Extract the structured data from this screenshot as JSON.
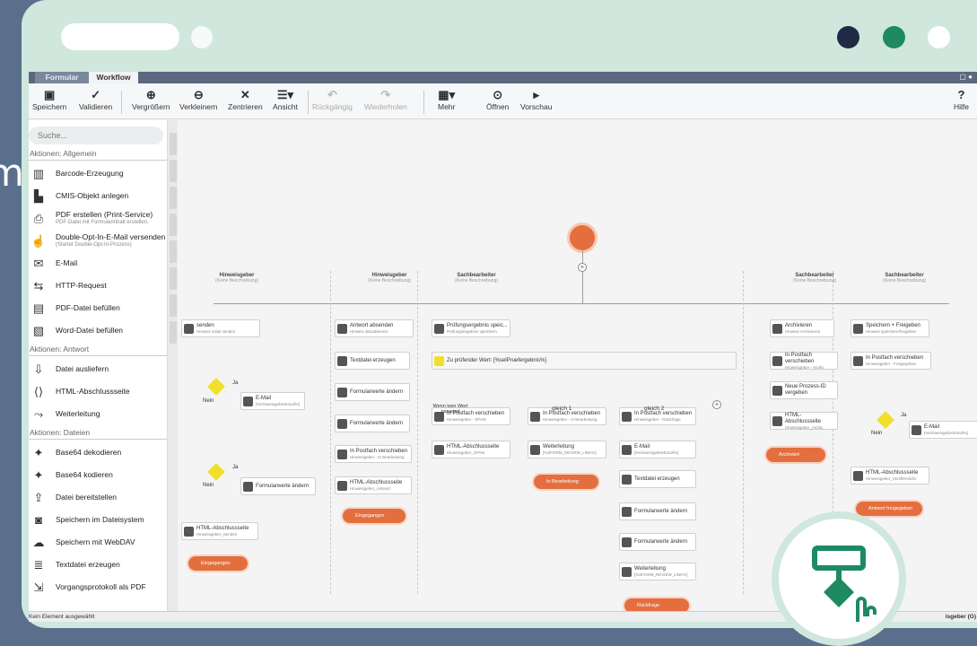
{
  "tabs": {
    "formular": "Formular",
    "workflow": "Workflow"
  },
  "toolbar": {
    "save": "Speichern",
    "validate": "Validieren",
    "zoom_in": "Vergrößern",
    "zoom_out": "Verkleinern",
    "center": "Zentrieren",
    "view": "Ansicht",
    "undo": "Rückgängig",
    "redo": "Wiederholen",
    "more": "Mehr",
    "open": "Öffnen",
    "preview": "Vorschau",
    "help": "Hilfe"
  },
  "search": {
    "placeholder": "Suche..."
  },
  "sections": [
    {
      "title": "Aktionen: Allgemein",
      "items": [
        {
          "label": "Barcode-Erzeugung",
          "sub": "",
          "icon": "barcode-icon"
        },
        {
          "label": "CMIS-Objekt anlegen",
          "sub": "",
          "icon": "cmis-icon"
        },
        {
          "label": "PDF erstellen (Print-Service)",
          "sub": "PDF-Datei mit Formularinhalt erstellen.",
          "icon": "printer-icon"
        },
        {
          "label": "Double-Opt-In-E-Mail versenden",
          "sub": "(Startet Double-Opt-In-Prozess)",
          "icon": "hand-icon"
        },
        {
          "label": "E-Mail",
          "sub": "",
          "icon": "mail-icon"
        },
        {
          "label": "HTTP-Request",
          "sub": "",
          "icon": "http-icon"
        },
        {
          "label": "PDF-Datei befüllen",
          "sub": "",
          "icon": "pdf-icon"
        },
        {
          "label": "Word-Datei befüllen",
          "sub": "",
          "icon": "word-icon"
        }
      ]
    },
    {
      "title": "Aktionen: Antwort",
      "items": [
        {
          "label": "Datei ausliefern",
          "sub": "",
          "icon": "download-icon"
        },
        {
          "label": "HTML-Abschlussseite",
          "sub": "",
          "icon": "html-icon"
        },
        {
          "label": "Weiterleitung",
          "sub": "",
          "icon": "redirect-icon"
        }
      ]
    },
    {
      "title": "Aktionen: Dateien",
      "items": [
        {
          "label": "Base64 dekodieren",
          "sub": "",
          "icon": "wand-icon"
        },
        {
          "label": "Base64 kodieren",
          "sub": "",
          "icon": "wand-icon"
        },
        {
          "label": "Datei bereitstellen",
          "sub": "",
          "icon": "provide-icon"
        },
        {
          "label": "Speichern im Dateisystem",
          "sub": "",
          "icon": "disk-icon"
        },
        {
          "label": "Speichern mit WebDAV",
          "sub": "",
          "icon": "cloud-icon"
        },
        {
          "label": "Textdatei erzeugen",
          "sub": "",
          "icon": "textfile-icon"
        },
        {
          "label": "Vorgangsprotokoll als PDF",
          "sub": "",
          "icon": "protocol-icon"
        }
      ]
    }
  ],
  "lanes": [
    {
      "title": "Hinweisgeber",
      "sub": "(Keine Beschreibung)"
    },
    {
      "title": "Hinweisgeber",
      "sub": "(Keine Beschreibung)"
    },
    {
      "title": "Sachbearbeiter",
      "sub": "(Keine Beschreibung)"
    },
    {
      "title": "Sachbearbeiter",
      "sub": "(Keine Beschreibung)"
    },
    {
      "title": "Sachbearbeiter",
      "sub": "(Keine Beschreibung)"
    }
  ],
  "nodes": [
    {
      "t": "senden",
      "s": "Hinweis initial senden"
    },
    {
      "t": "E-Mail",
      "s": "[%HinweisgeberEmail%]"
    },
    {
      "t": "Formularwerte ändern",
      "s": ""
    },
    {
      "t": "HTML-Abschlussseite",
      "s": "Hinweisgeber_Senden"
    },
    {
      "t": "Antwort absenden",
      "s": "Hinweis aktualisieren"
    },
    {
      "t": "Textdatei erzeugen",
      "s": ""
    },
    {
      "t": "Formularwerte ändern",
      "s": ""
    },
    {
      "t": "Formularwerte ändern",
      "s": ""
    },
    {
      "t": "In Postfach verschieben",
      "s": "Hinweisgeber - In Bearbeitung"
    },
    {
      "t": "HTML-Abschlussseite",
      "s": "Hinweisgeber_Antwort"
    },
    {
      "t": "Prüfungsergebnis speic...",
      "s": "Prüfungsergebnis speichern"
    },
    {
      "t": "Zu prüfender Wert: [%selPruefergebnis%]",
      "s": ""
    },
    {
      "t": "In Postfach verschieben",
      "s": "Hinweisgeber - SPAM"
    },
    {
      "t": "HTML-Abschlussseite",
      "s": "Hinweisgeber_SPAM"
    },
    {
      "t": "In Postfach verschieben",
      "s": "Hinweisgeber - In Bearbeitung"
    },
    {
      "t": "Weiterleitung",
      "s": "[%SFORM_REVIEW_LINK%]"
    },
    {
      "t": "In Postfach verschieben",
      "s": "Hinweisgeber - Rückfrage"
    },
    {
      "t": "E-Mail",
      "s": "[%HinweisgeberEmail%]"
    },
    {
      "t": "Textdatei erzeugen",
      "s": ""
    },
    {
      "t": "Formularwerte ändern",
      "s": ""
    },
    {
      "t": "Formularwerte ändern",
      "s": ""
    },
    {
      "t": "Weiterleitung",
      "s": "[%SFORM_REVIEW_LINK%]"
    },
    {
      "t": "Archivieren",
      "s": "Hinweis Archivieren"
    },
    {
      "t": "In Postfach verschieben",
      "s": "Hinweisgeber - Archiv"
    },
    {
      "t": "Neue Prozess-ID vergeben",
      "s": ""
    },
    {
      "t": "HTML-Abschlussseite",
      "s": "Hinweisgeber_Archiv"
    },
    {
      "t": "Speichern + Freigeben",
      "s": "Hinweis speichern/freigeben"
    },
    {
      "t": "In Postfach verschieben",
      "s": "Hinweisgeber - Freigegeben"
    },
    {
      "t": "E-Mail",
      "s": "[%HinweisgeberEmail%]"
    },
    {
      "t": "HTML-Abschlussseite",
      "s": "Hinweisgeber_Veröffentlicht"
    }
  ],
  "ends": [
    "Eingegangen",
    "Eingegangen",
    "Spam",
    "In Bearbeitung",
    "Rückfrage",
    "Archiviert",
    "Antwort freigegeben"
  ],
  "labels": {
    "ja1": "Ja",
    "nein1": "Nein",
    "ja2": "Ja",
    "nein2": "Nein",
    "ja3": "Ja",
    "nein3": "Nein",
    "kein": "Wenn kein Wert passend",
    "g1": "gleich 1",
    "g2": "gleich 2"
  },
  "status": {
    "left": "Kein Element ausgewählt",
    "right": "isgeber (G)"
  },
  "bg_fragment": "m"
}
